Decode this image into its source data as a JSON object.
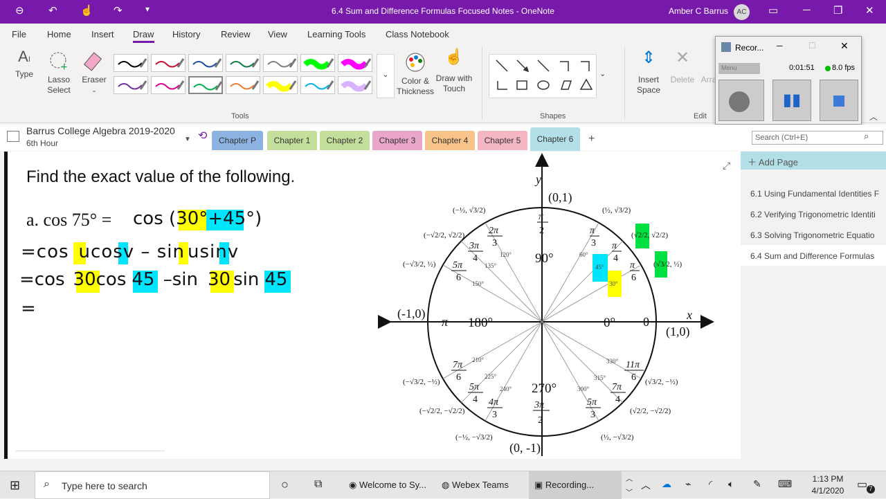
{
  "titlebar": {
    "title": "6.4 Sum and Difference Formulas Focused Notes  -  OneNote",
    "user": "Amber C Barrus",
    "initials": "AC"
  },
  "menu": [
    "File",
    "Home",
    "Insert",
    "Draw",
    "History",
    "Review",
    "View",
    "Learning Tools",
    "Class Notebook"
  ],
  "ribbon": {
    "type": "Type",
    "lasso": "Lasso Select",
    "eraser": "Eraser",
    "color_thickness": "Color & Thickness",
    "draw_touch": "Draw with Touch",
    "tools_label": "Tools",
    "shapes_label": "Shapes",
    "insert_space": "Insert Space",
    "delete": "Delete",
    "arrange": "Arra",
    "edit_label": "Edit"
  },
  "pen_colors": [
    "#000000",
    "#c8102e",
    "#1f4e9c",
    "#107c41",
    "#7f7f7f",
    "#00ff00",
    "#ff00ff",
    "#7030a0",
    "#e3008c",
    "#00b050",
    "#ed7d31",
    "#ffff00",
    "#00b0f0",
    "#d9b3ff"
  ],
  "recorder": {
    "title": "Recor...",
    "menu": "Menu",
    "time": "0:01:51",
    "fps": "8.0 fps"
  },
  "notebook": {
    "name": "Barrus College Algebra 2019-2020",
    "section": "6th Hour"
  },
  "tabs": [
    {
      "label": "Chapter P",
      "color": "#8db3e2"
    },
    {
      "label": "Chapter 1",
      "color": "#c4df9b"
    },
    {
      "label": "Chapter 2",
      "color": "#c4df9b"
    },
    {
      "label": "Chapter 3",
      "color": "#e9a6c8"
    },
    {
      "label": "Chapter 4",
      "color": "#f8c48a"
    },
    {
      "label": "Chapter 5",
      "color": "#f4b6c2"
    },
    {
      "label": "Chapter 6",
      "color": "#b3e0e8"
    }
  ],
  "search_placeholder": "Search (Ctrl+E)",
  "pages": {
    "add": "Add Page",
    "items": [
      "6.1 Using Fundamental Identities F",
      "6.2 Verifying Trigonometric Identiti",
      "6.3 Solving Trigonometric Equatio",
      "6.4 Sum and Difference Formulas"
    ]
  },
  "note": {
    "heading": "Find the exact value of the following.",
    "line_a_label": "a.  cos 75° =",
    "line_a_rest": "cos (",
    "a_30": "30°",
    "a_plus": "+",
    "a_45": "45°",
    "a_close": ")",
    "line2": [
      "=cos",
      "u",
      "cos",
      "v",
      " – sin",
      "u",
      "sin",
      "v"
    ],
    "line3": [
      "=cos",
      "30",
      "cos",
      "45",
      " –sin",
      "30",
      "sin",
      "45"
    ],
    "line4": "="
  },
  "circle": {
    "y": "y",
    "x": "x",
    "top": "(0,1)",
    "bottom": "(0, -1)",
    "left": "(-1,0)",
    "right": "(1,0)",
    "deg90": "90°",
    "deg180": "180°",
    "deg0": "0°",
    "deg270": "270°",
    "pi": "π",
    "zero": "0",
    "small_degrees": [
      "60°",
      "45°",
      "30°",
      "120°",
      "135°",
      "150°",
      "210°",
      "225°",
      "240°",
      "300°",
      "315°",
      "330°"
    ]
  },
  "taskbar": {
    "search": "Type here to search",
    "apps": [
      "Welcome to Sy...",
      "Webex Teams",
      "Recording..."
    ],
    "time": "1:13 PM",
    "date": "4/1/2020",
    "notif": "7"
  }
}
